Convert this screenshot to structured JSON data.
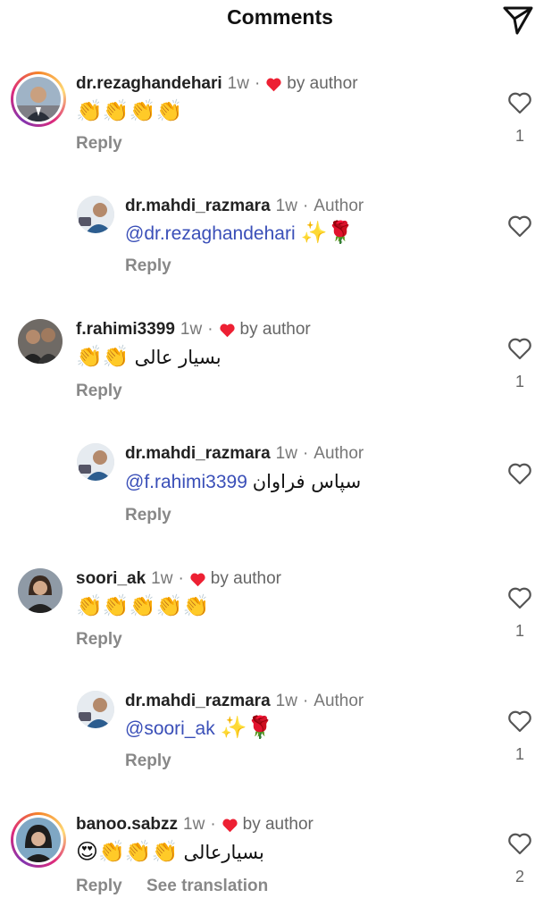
{
  "header": {
    "title": "Comments"
  },
  "colors": {
    "heart_red": "#ed2033",
    "mention_blue": "#3a4fb8",
    "muted_gray": "#888888"
  },
  "labels": {
    "reply": "Reply",
    "see_translation": "See translation",
    "by_author": "by author",
    "author": "Author",
    "dot": "·"
  },
  "comments": [
    {
      "username": "dr.rezaghandehari",
      "time": "1w",
      "liked_by_author": true,
      "emoji_text": "👏👏👏👏",
      "likes": "1",
      "avatar_icon": "man-suit-avatar"
    },
    {
      "username": "dr.mahdi_razmara",
      "time": "1w",
      "is_author": true,
      "mention": "@dr.rezaghandehari",
      "text_after": "✨🌹",
      "likes": "",
      "avatar_icon": "doctor-avatar"
    },
    {
      "username": "f.rahimi3399",
      "time": "1w",
      "liked_by_author": true,
      "text": "بسیار عالی",
      "emoji_text": "👏👏",
      "likes": "1",
      "avatar_icon": "two-men-avatar"
    },
    {
      "username": "dr.mahdi_razmara",
      "time": "1w",
      "is_author": true,
      "mention": "@f.rahimi3399",
      "text": "سپاس فراوان",
      "likes": "",
      "avatar_icon": "doctor-avatar"
    },
    {
      "username": "soori_ak",
      "time": "1w",
      "liked_by_author": true,
      "emoji_text": "👏👏👏👏👏",
      "likes": "1",
      "avatar_icon": "woman-avatar"
    },
    {
      "username": "dr.mahdi_razmara",
      "time": "1w",
      "is_author": true,
      "mention": "@soori_ak",
      "text_after": "✨🌹",
      "likes": "1",
      "avatar_icon": "doctor-avatar"
    },
    {
      "username": "banoo.sabzz",
      "time": "1w",
      "liked_by_author": true,
      "text": "بسیارعالی",
      "emoji_text": "😍👏👏👏",
      "likes": "2",
      "avatar_icon": "woman-hijab-avatar"
    }
  ]
}
